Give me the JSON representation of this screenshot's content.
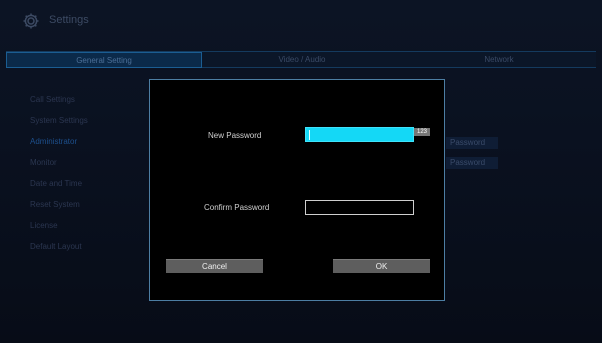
{
  "header": {
    "title": "Settings",
    "icon": "gear-icon"
  },
  "tabs": [
    {
      "label": "General Setting",
      "active": true
    },
    {
      "label": "Video / Audio",
      "active": false
    },
    {
      "label": "Network",
      "active": false
    }
  ],
  "sidebar": {
    "items": [
      {
        "label": "Call Settings"
      },
      {
        "label": "System Settings"
      },
      {
        "label": "Administrator",
        "active": true
      },
      {
        "label": "Monitor"
      },
      {
        "label": "Date and Time"
      },
      {
        "label": "Reset System"
      },
      {
        "label": "License"
      },
      {
        "label": "Default Layout"
      }
    ]
  },
  "background_buttons": [
    "Password",
    "Password"
  ],
  "dialog": {
    "new_password_label": "New Password",
    "new_password_value": "",
    "ime_mode": "123",
    "confirm_password_label": "Confirm Password",
    "confirm_password_value": "",
    "cancel_label": "Cancel",
    "ok_label": "OK"
  },
  "colors": {
    "focused_input": "#14d8f6",
    "dialog_border": "#4d7ea3",
    "button_bg": "#5e5e5e"
  }
}
